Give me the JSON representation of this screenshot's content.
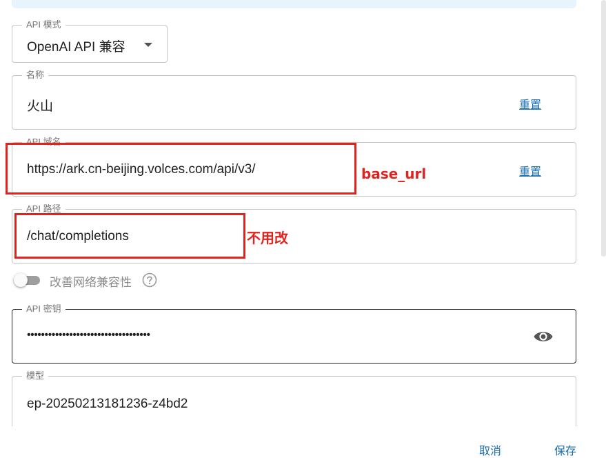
{
  "api_mode": {
    "label": "API 模式",
    "value": "OpenAI API 兼容"
  },
  "name_field": {
    "label": "名称",
    "value": "火山",
    "reset_label": "重置"
  },
  "domain_field": {
    "label": "API 域名",
    "value": "https://ark.cn-beijing.volces.com/api/v3/",
    "reset_label": "重置"
  },
  "path_field": {
    "label": "API 路径",
    "value": "/chat/completions"
  },
  "compat_toggle": {
    "label": "改善网络兼容性",
    "enabled": false
  },
  "key_field": {
    "label": "API 密钥",
    "value": "•••••••••••••••••••••••••••••••••••"
  },
  "model_field": {
    "label": "模型",
    "value": "ep-20250213181236-z4bd2"
  },
  "annotations": {
    "base_url": "base_url",
    "no_change": "不用改"
  },
  "footer": {
    "cancel_label": "取消",
    "save_label": "保存"
  },
  "colors": {
    "accent": "#1a6fb0",
    "annotation": "#e0231e",
    "border": "#c4c4c4"
  }
}
